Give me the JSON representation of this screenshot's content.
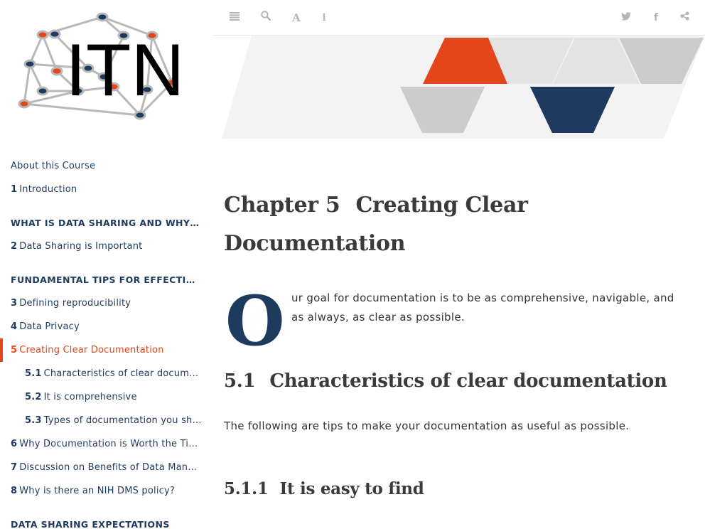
{
  "logo": {
    "text": "ITN"
  },
  "toolbar": {
    "left_icons": [
      "menu-icon",
      "search-icon",
      "font-icon",
      "info-icon"
    ],
    "right_icons": [
      "twitter-icon",
      "facebook-icon",
      "share-icon"
    ]
  },
  "colors": {
    "accent": "#e3461b",
    "navy": "#1e3a5f",
    "banner_gray": "#cfcfcf",
    "banner_light": "#e5e5e5"
  },
  "toc": {
    "about": "About this Course",
    "intro_num": "1",
    "intro": "Introduction",
    "part1": "WHAT IS DATA SHARING AND WHY IS I…",
    "c2_num": "2",
    "c2": "Data Sharing is Important",
    "part2": "FUNDAMENTAL TIPS FOR EFFECTIVE D…",
    "c3_num": "3",
    "c3": "Defining reproducibility",
    "c4_num": "4",
    "c4": "Data Privacy",
    "c5_num": "5",
    "c5": "Creating Clear Documentation",
    "s51_num": "5.1",
    "s51": "Characteristics of clear document…",
    "s52_num": "5.2",
    "s52": "It is comprehensive",
    "s53_num": "5.3",
    "s53": "Types of documentation you shou…",
    "c6_num": "6",
    "c6": "Why Documentation is Worth the Time",
    "c7_num": "7",
    "c7": "Discussion on Benefits of Data Manag…",
    "c8_num": "8",
    "c8": "Why is there an NIH DMS policy?",
    "part3": "DATA SHARING EXPECTATIONS"
  },
  "content": {
    "chapter_num": "Chapter 5",
    "chapter_title_1": "Creating Clear",
    "chapter_title_2": "Documentation",
    "dropcap": "O",
    "intro": "ur goal for documentation is to be as comprehensive, navigable, and as always, as clear as possible.",
    "h2_num": "5.1",
    "h2_title": "Characteristics of clear documentation",
    "para": "The following are tips to make your documentation as useful as possible.",
    "h3_num": "5.1.1",
    "h3_title": "It is easy to find"
  }
}
